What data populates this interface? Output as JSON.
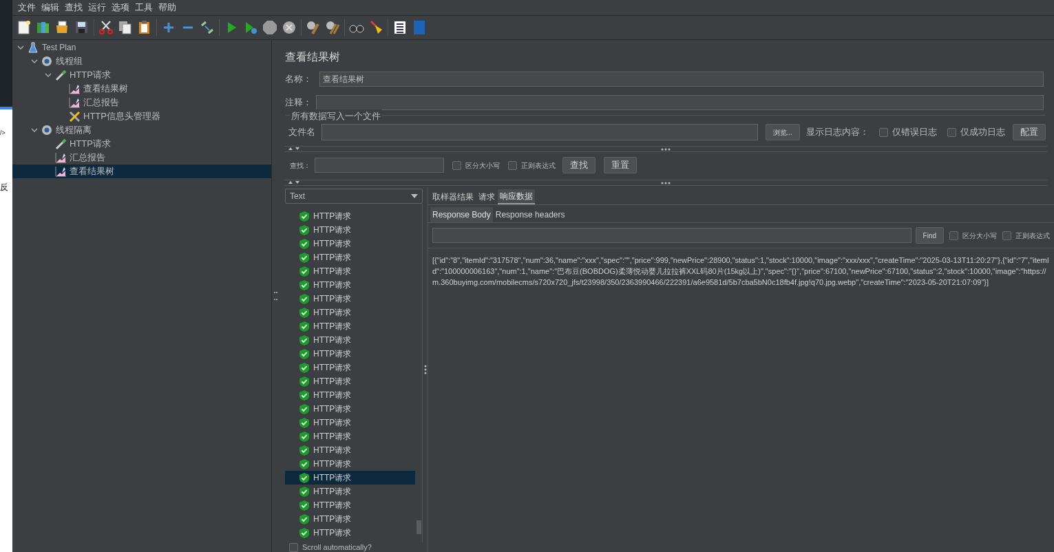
{
  "background_window": {
    "texts": [
      "/>",
      "反"
    ]
  },
  "menu": [
    "文件",
    "编辑",
    "查找",
    "运行",
    "选项",
    "工具",
    "帮助"
  ],
  "tree": [
    {
      "label": "Test Plan",
      "kind": "plan",
      "expanded": true,
      "selected": false,
      "children": [
        {
          "label": "线程组",
          "kind": "group",
          "expanded": true,
          "selected": false,
          "children": [
            {
              "label": "HTTP请求",
              "kind": "sampler",
              "expanded": true,
              "selected": false,
              "children": [
                {
                  "label": "查看结果树",
                  "kind": "listener",
                  "selected": false
                },
                {
                  "label": "汇总报告",
                  "kind": "listener",
                  "selected": false
                },
                {
                  "label": "HTTP信息头管理器",
                  "kind": "config",
                  "selected": false
                }
              ]
            }
          ]
        },
        {
          "label": "线程隔离",
          "kind": "group",
          "expanded": true,
          "selected": false,
          "children": [
            {
              "label": "HTTP请求",
              "kind": "sampler",
              "selected": false
            },
            {
              "label": "汇总报告",
              "kind": "listener",
              "selected": false
            },
            {
              "label": "查看结果树",
              "kind": "listener",
              "selected": true
            }
          ]
        }
      ]
    }
  ],
  "panel": {
    "title": "查看结果树",
    "name_label": "名称：",
    "name_value": "查看结果树",
    "comment_label": "注释：",
    "file_group": {
      "legend": "所有数据写入一个文件",
      "file_label": "文件名",
      "browse": "浏览...",
      "log_label": "显示日志内容：",
      "checks": [
        {
          "label": "仅错误日志",
          "checked": false
        },
        {
          "label": "仅成功日志",
          "checked": false
        }
      ],
      "config": "配置"
    },
    "search": {
      "label": "查找：",
      "checks": [
        {
          "label": "区分大小写",
          "checked": false
        },
        {
          "label": "正则表达式",
          "checked": false
        }
      ],
      "find": "查找",
      "reset": "重置"
    }
  },
  "results": {
    "renderer": "Text",
    "items": [
      {
        "label": "HTTP请求",
        "selected": false
      },
      {
        "label": "HTTP请求",
        "selected": false
      },
      {
        "label": "HTTP请求",
        "selected": false
      },
      {
        "label": "HTTP请求",
        "selected": false
      },
      {
        "label": "HTTP请求",
        "selected": false
      },
      {
        "label": "HTTP请求",
        "selected": false
      },
      {
        "label": "HTTP请求",
        "selected": false
      },
      {
        "label": "HTTP请求",
        "selected": false
      },
      {
        "label": "HTTP请求",
        "selected": false
      },
      {
        "label": "HTTP请求",
        "selected": false
      },
      {
        "label": "HTTP请求",
        "selected": false
      },
      {
        "label": "HTTP请求",
        "selected": false
      },
      {
        "label": "HTTP请求",
        "selected": false
      },
      {
        "label": "HTTP请求",
        "selected": false
      },
      {
        "label": "HTTP请求",
        "selected": false
      },
      {
        "label": "HTTP请求",
        "selected": false
      },
      {
        "label": "HTTP请求",
        "selected": false
      },
      {
        "label": "HTTP请求",
        "selected": false
      },
      {
        "label": "HTTP请求",
        "selected": false
      },
      {
        "label": "HTTP请求",
        "selected": true
      },
      {
        "label": "HTTP请求",
        "selected": false
      },
      {
        "label": "HTTP请求",
        "selected": false
      },
      {
        "label": "HTTP请求",
        "selected": false
      },
      {
        "label": "HTTP请求",
        "selected": false
      }
    ],
    "scroll_auto": {
      "label": "Scroll automatically?",
      "checked": false
    }
  },
  "detail": {
    "tabs": [
      {
        "label": "取样器结果",
        "selected": false
      },
      {
        "label": "请求",
        "selected": false
      },
      {
        "label": "响应数据",
        "selected": true
      }
    ],
    "subtabs": [
      {
        "label": "Response Body",
        "selected": true
      },
      {
        "label": "Response headers",
        "selected": false
      }
    ],
    "find": "Find",
    "checks": [
      {
        "label": "区分大小写",
        "checked": false
      },
      {
        "label": "正则表达式",
        "checked": false
      }
    ],
    "body": "[{\"id\":\"8\",\"itemId\":\"317578\",\"num\":36,\"name\":\"xxx\",\"spec\":\"\",\"price\":999,\"newPrice\":28900,\"status\":1,\"stock\":10000,\"image\":\"xxx/xxx\",\"createTime\":\"2025-03-13T11:20:27\"},{\"id\":\"7\",\"itemId\":\"100000006163\",\"num\":1,\"name\":\"巴布豆(BOBDOG)柔薄悦动婴儿拉拉裤XXL码80片(15kg以上)\",\"spec\":\"{}\",\"price\":67100,\"newPrice\":67100,\"status\":2,\"stock\":10000,\"image\":\"https://m.360buyimg.com/mobilecms/s720x720_jfs/t23998/350/2363990466/222391/a6e9581d/5b7cba5bN0c18fb4f.jpg!q70.jpg.webp\",\"createTime\":\"2023-05-20T21:07:09\"}]"
  }
}
